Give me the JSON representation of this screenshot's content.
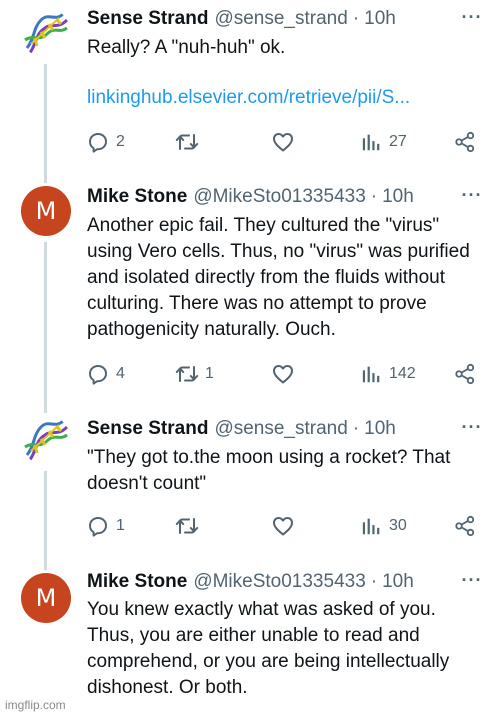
{
  "tweets": [
    {
      "name": "Sense Strand",
      "handle": "@sense_strand",
      "time": "10h",
      "text": "Really? A \"nuh-huh\" ok.",
      "link": "linkinghub.elsevier.com/retrieve/pii/S...",
      "replies": "2",
      "retweets": "",
      "views": "27",
      "avatar": "dna-helix-logo"
    },
    {
      "name": "Mike Stone",
      "handle": "@MikeSto01335433",
      "time": "10h",
      "text": "Another epic fail. They cultured the \"virus\" using Vero cells. Thus, no \"virus\" was purified and isolated directly from the fluids without culturing. There was no attempt to prove pathogenicity naturally. Ouch.",
      "replies": "4",
      "retweets": "1",
      "views": "142",
      "avatar_letter": "M"
    },
    {
      "name": "Sense Strand",
      "handle": "@sense_strand",
      "time": "10h",
      "text": "\"They got to.the moon using a rocket? That doesn't count\"",
      "replies": "1",
      "retweets": "",
      "views": "30",
      "avatar": "dna-helix-logo"
    },
    {
      "name": "Mike Stone",
      "handle": "@MikeSto01335433",
      "time": "10h",
      "text": "You knew exactly what was asked of you. Thus, you are either unable to read and comprehend, or you are being intellectually dishonest. Or both.",
      "avatar_letter": "M"
    }
  ],
  "separator": "·",
  "more_glyph": "···",
  "colors": {
    "accent_link": "#1d9bf0",
    "muted_text": "#536471",
    "avatar_m": "#c6451f",
    "thread_line": "#cfd9de"
  },
  "watermark": "imgflip.com"
}
